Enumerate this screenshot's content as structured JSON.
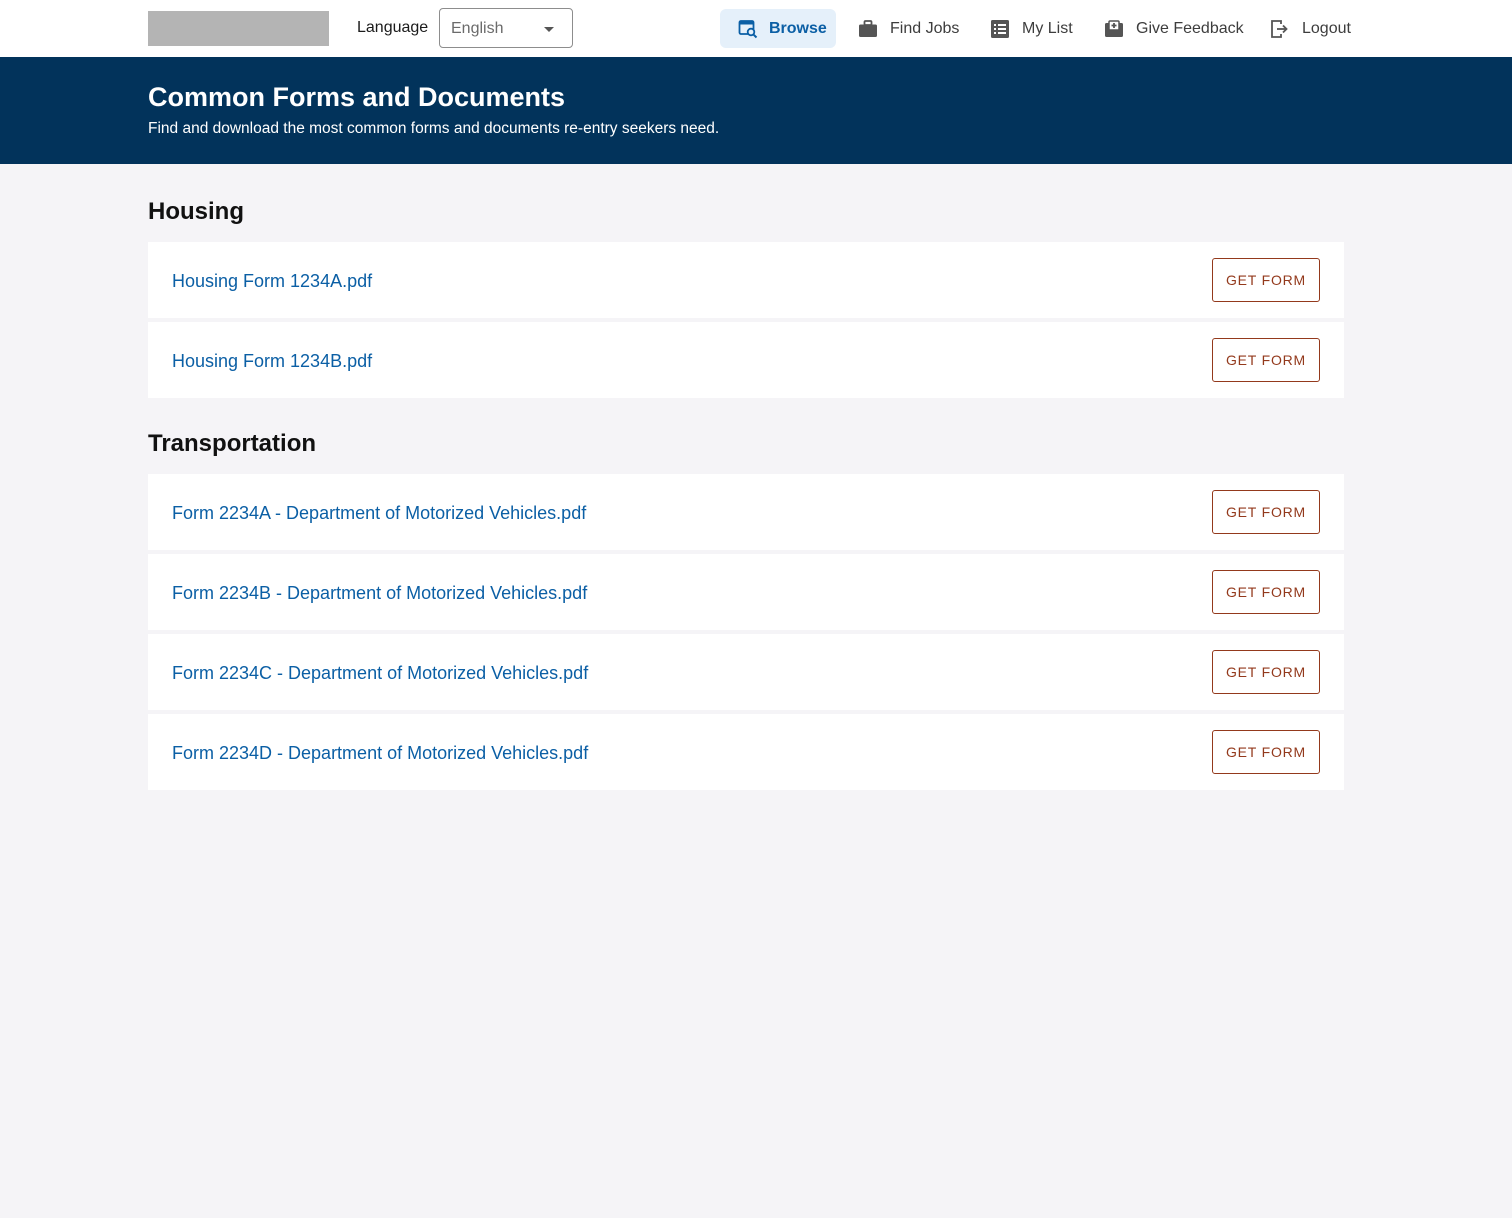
{
  "header": {
    "logo": "logo-placeholder",
    "language_label": "Language",
    "language_selected": "English",
    "nav": {
      "browse": "Browse",
      "find_jobs": "Find Jobs",
      "my_list": "My List",
      "give_feedback": "Give Feedback",
      "logout": "Logout"
    },
    "icons": [
      "browse-icon",
      "briefcase-icon",
      "list-icon",
      "feedback-icon",
      "logout-icon",
      "chevron-down-icon"
    ]
  },
  "hero": {
    "title": "Common Forms and Documents",
    "subtitle": "Find and download the most common forms and documents re-entry seekers need."
  },
  "sections": [
    {
      "title": "Housing",
      "items": [
        {
          "name": "Housing Form 1234A.pdf",
          "button": "GET FORM"
        },
        {
          "name": "Housing Form 1234B.pdf",
          "button": "GET FORM"
        }
      ]
    },
    {
      "title": "Transportation",
      "items": [
        {
          "name": "Form 2234A - Department of Motorized Vehicles.pdf",
          "button": "GET FORM"
        },
        {
          "name": "Form 2234B - Department of Motorized Vehicles.pdf",
          "button": "GET FORM"
        },
        {
          "name": "Form 2234C - Department of Motorized Vehicles.pdf",
          "button": "GET FORM"
        },
        {
          "name": "Form 2234D - Department of Motorized Vehicles.pdf",
          "button": "GET FORM"
        }
      ]
    }
  ],
  "colors": {
    "hero_bg": "#02335b",
    "link": "#0b5fa5",
    "button": "#93391c",
    "page_bg": "#f5f4f7",
    "active_nav_bg": "#e5f0fa"
  }
}
